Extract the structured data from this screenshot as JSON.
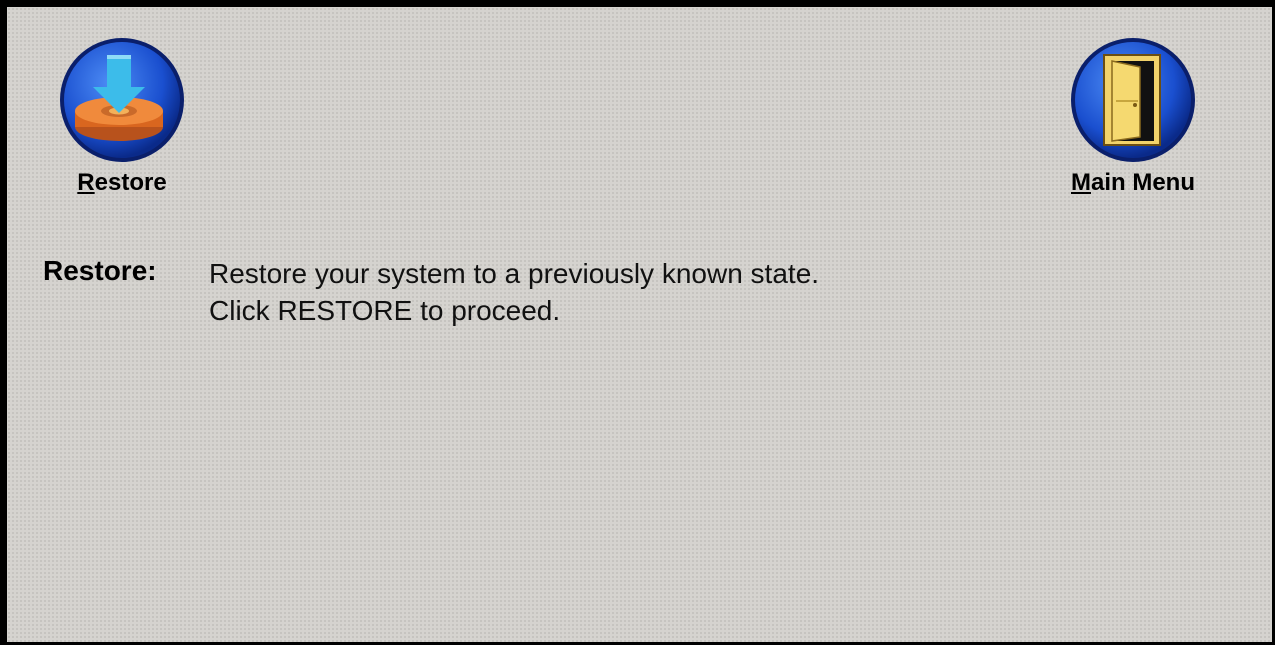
{
  "toolbar": {
    "restore": {
      "label_mnemonic": "R",
      "label_rest": "estore",
      "icon": "restore-disk-icon"
    },
    "main_menu": {
      "label_mnemonic": "M",
      "label_rest": "ain Menu",
      "icon": "door-exit-icon"
    }
  },
  "description": {
    "heading": "Restore:",
    "lines": [
      "Restore your system to a previously known state.",
      "Click RESTORE to proceed."
    ]
  },
  "colors": {
    "background": "#d5d3cf",
    "icon_circle": "#1b59d6",
    "arrow": "#37b6e6",
    "disk": "#e6782e",
    "door": "#f2d36b"
  }
}
